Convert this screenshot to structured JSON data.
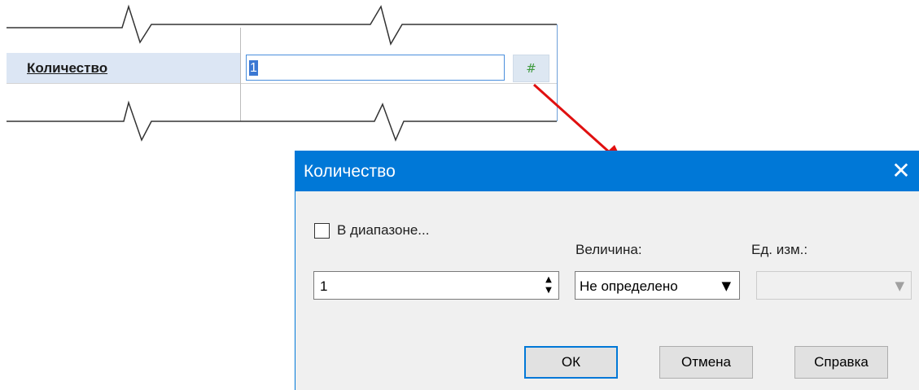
{
  "property_grid": {
    "label": "Количество",
    "input_value": "1",
    "hash_button": "#"
  },
  "dialog": {
    "title": "Количество",
    "close_glyph": "✕",
    "range_checkbox_label": "В диапазоне...",
    "range_checked": false,
    "value_spin": "1",
    "magnitude_label": "Величина:",
    "magnitude_value": "Не определено",
    "unit_label": "Ед. изм.:",
    "unit_value": "",
    "ok_label": "ОК",
    "cancel_label": "Отмена",
    "help_label": "Справка"
  },
  "colors": {
    "titlebar": "#0078d7",
    "arrow": "#e01010",
    "hash_icon": "#3f9a3f",
    "label_row": "#dce6f4"
  },
  "icons": [
    "hash-icon",
    "close-icon",
    "spin-arrows-icon",
    "dropdown-arrow-icon",
    "red-arrow-icon"
  ]
}
